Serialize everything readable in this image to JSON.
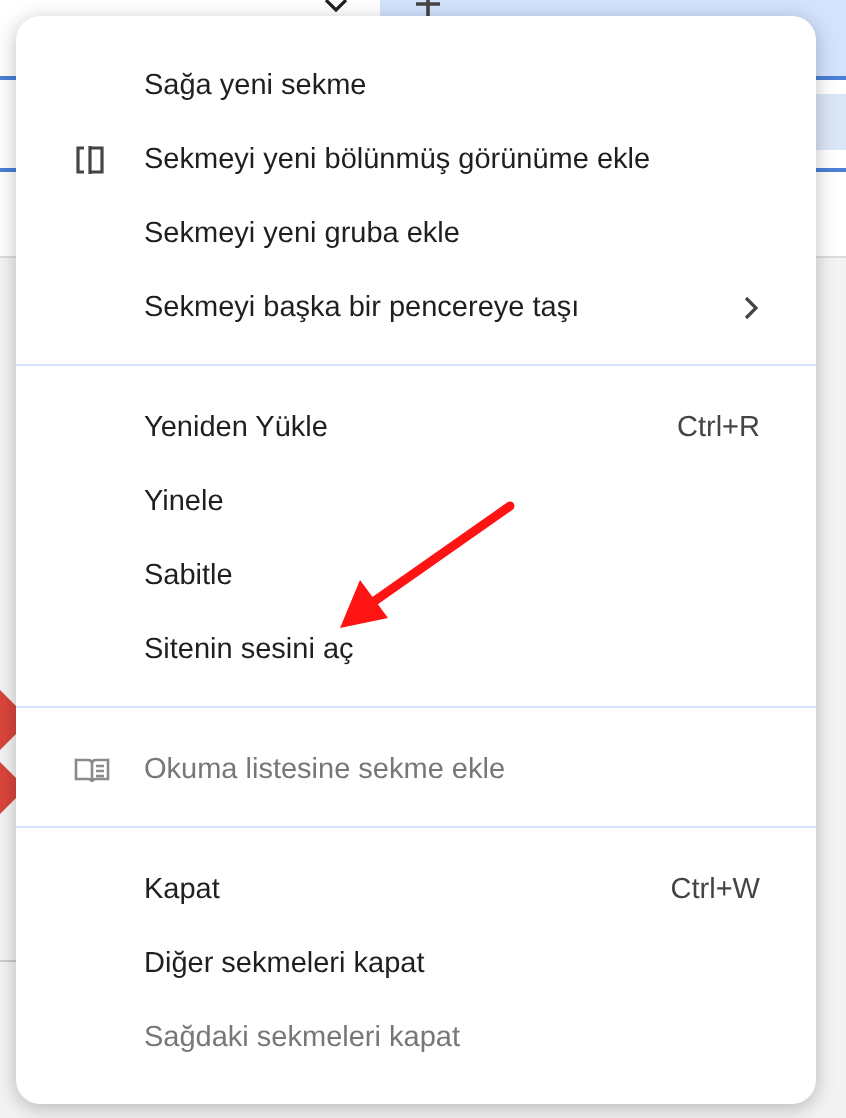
{
  "menu": {
    "sections": [
      {
        "items": [
          {
            "label": "Sağa yeni sekme",
            "disabled": false
          },
          {
            "label": "Sekmeyi yeni bölünmüş görünüme ekle",
            "kind": "split_view",
            "disabled": false
          },
          {
            "label": "Sekmeyi yeni gruba ekle",
            "disabled": false
          },
          {
            "label": "Sekmeyi başka bir pencereye taşı",
            "submenu": true,
            "disabled": false
          }
        ]
      },
      {
        "items": [
          {
            "label": "Yeniden Yükle",
            "shortcut": "Ctrl+R",
            "disabled": false
          },
          {
            "label": "Yinele",
            "disabled": false
          },
          {
            "label": "Sabitle",
            "disabled": false
          },
          {
            "label": "Sitenin sesini aç",
            "disabled": false
          }
        ]
      },
      {
        "items": [
          {
            "label": "Okuma listesine sekme ekle",
            "kind": "reading_list",
            "disabled": true
          }
        ]
      },
      {
        "items": [
          {
            "label": "Kapat",
            "shortcut": "Ctrl+W",
            "disabled": false
          },
          {
            "label": "Diğer sekmeleri kapat",
            "disabled": false
          },
          {
            "label": "Sağdaki sekmeleri kapat",
            "disabled": true
          }
        ]
      }
    ]
  },
  "annotation": {
    "kind": "arrow"
  }
}
